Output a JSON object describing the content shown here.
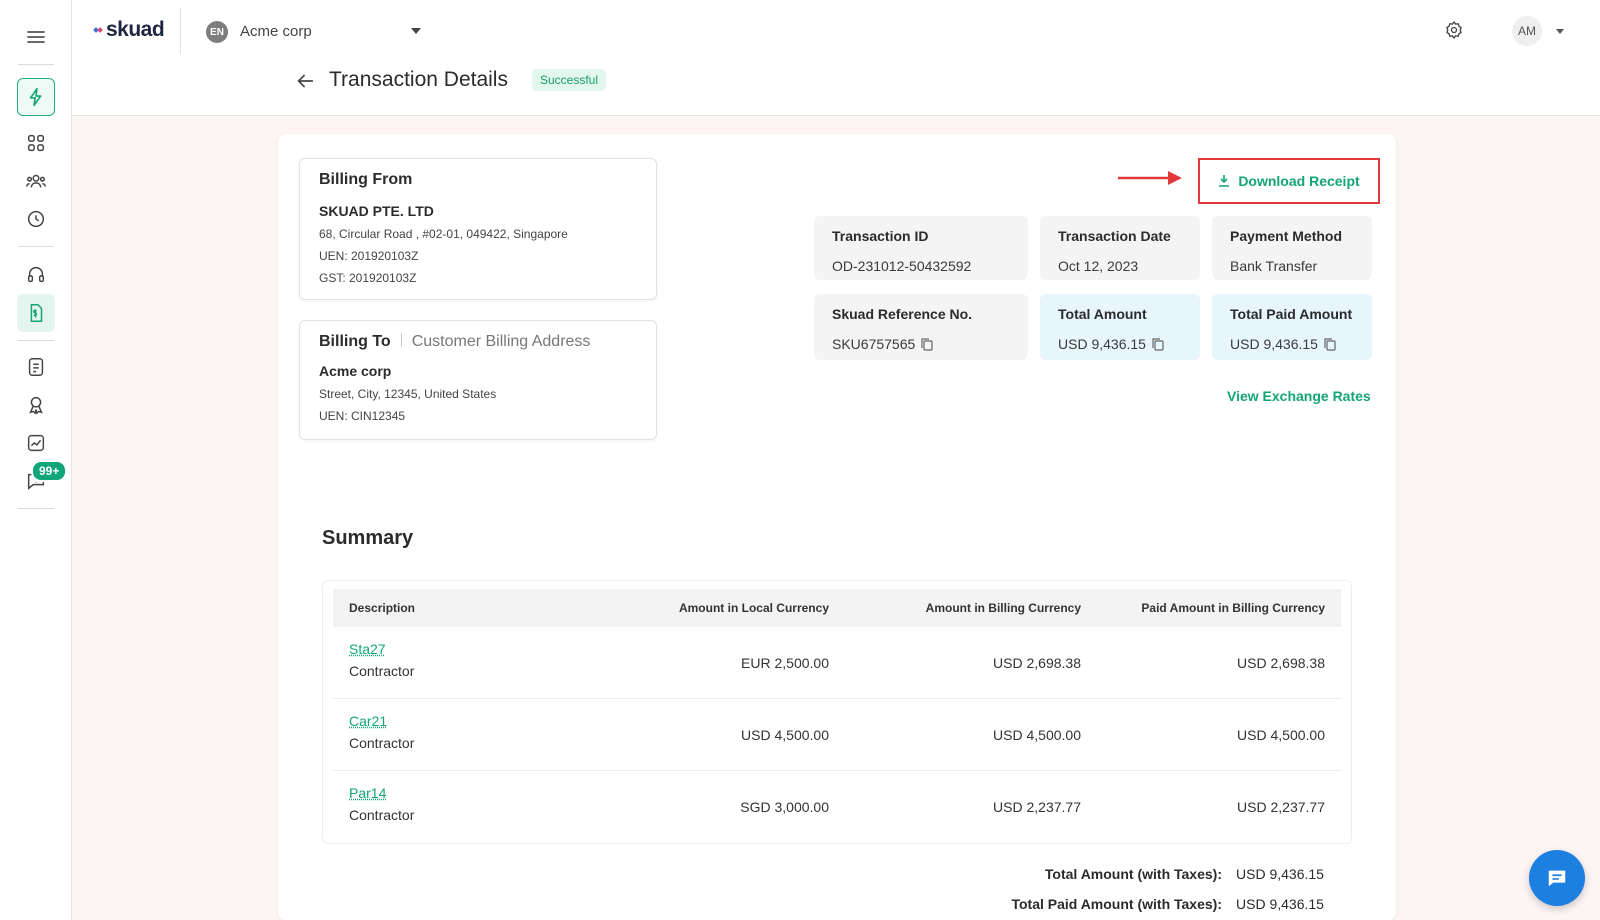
{
  "org": {
    "avatar": "EN",
    "name": "Acme corp"
  },
  "user": {
    "avatar": "AM"
  },
  "logo": "skuad",
  "page": {
    "title": "Transaction Details",
    "status": "Successful"
  },
  "rail": {
    "badge": "99+"
  },
  "billing_from": {
    "heading": "Billing From",
    "company": "SKUAD PTE. LTD",
    "address": "68, Circular Road , #02-01, 049422, Singapore",
    "uen": "UEN: 201920103Z",
    "gst": "GST: 201920103Z"
  },
  "billing_to": {
    "heading": "Billing To",
    "sub": "Customer Billing Address",
    "company": "Acme corp",
    "address": "Street, City, 12345, United States",
    "uen": "UEN: CIN12345"
  },
  "download_label": "Download Receipt",
  "tiles": [
    {
      "label": "Transaction ID",
      "value": "OD-231012-50432592"
    },
    {
      "label": "Transaction Date",
      "value": "Oct 12, 2023"
    },
    {
      "label": "Payment Method",
      "value": "Bank Transfer"
    },
    {
      "label": "Skuad Reference No.",
      "value": "SKU6757565"
    },
    {
      "label": "Total Amount",
      "value": "USD 9,436.15"
    },
    {
      "label": "Total Paid Amount",
      "value": "USD 9,436.15"
    }
  ],
  "view_rates": "View Exchange Rates",
  "summary": {
    "title": "Summary",
    "columns": [
      "Description",
      "Amount in Local Currency",
      "Amount in Billing Currency",
      "Paid Amount in Billing Currency"
    ],
    "rows": [
      {
        "name": "Sta27",
        "role": "Contractor",
        "local": "EUR 2,500.00",
        "billing": "USD 2,698.38",
        "paid": "USD 2,698.38"
      },
      {
        "name": "Car21",
        "role": "Contractor",
        "local": "USD 4,500.00",
        "billing": "USD 4,500.00",
        "paid": "USD 4,500.00"
      },
      {
        "name": "Par14",
        "role": "Contractor",
        "local": "SGD 3,000.00",
        "billing": "USD 2,237.77",
        "paid": "USD 2,237.77"
      }
    ],
    "total_label": "Total Amount (with Taxes):",
    "total_value": "USD 9,436.15",
    "paid_label": "Total Paid Amount (with Taxes):",
    "paid_value": "USD 9,436.15"
  },
  "colors": {
    "accent": "#13a575",
    "highlight_border": "#e03a3a",
    "chat": "#1d7fe0"
  }
}
